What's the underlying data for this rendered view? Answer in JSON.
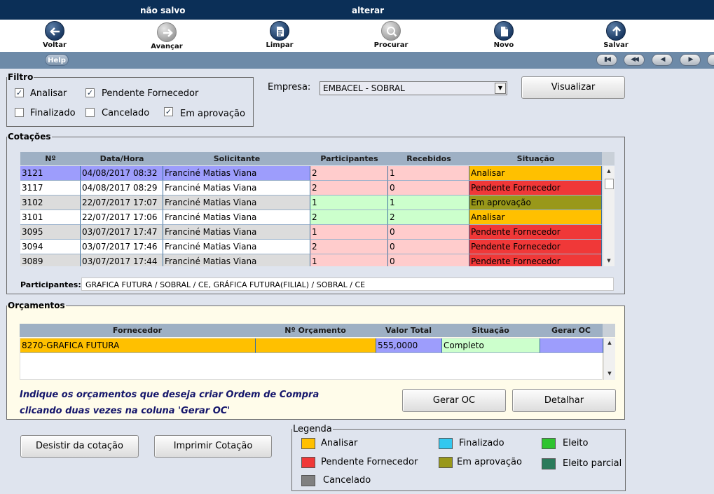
{
  "topbar": {
    "status": "não salvo",
    "mode": "alterar"
  },
  "toolbar": [
    {
      "label": "Voltar",
      "icon": "arrow-left-icon"
    },
    {
      "label": "Avançar",
      "icon": "arrow-right-icon"
    },
    {
      "label": "Limpar",
      "icon": "clear-document-icon"
    },
    {
      "label": "Procurar",
      "icon": "search-icon"
    },
    {
      "label": "Novo",
      "icon": "new-document-icon"
    },
    {
      "label": "Salvar",
      "icon": "save-up-arrow-icon"
    }
  ],
  "helpbar": {
    "help_label": "Help",
    "nav_icons": [
      "first-page-icon",
      "rewind-icon",
      "previous-icon",
      "next-icon",
      "last-icon"
    ]
  },
  "filtro": {
    "title": "Filtro",
    "options": [
      {
        "label": "Analisar",
        "checked": true
      },
      {
        "label": "Pendente Fornecedor",
        "checked": true
      },
      {
        "label": "Finalizado",
        "checked": false
      },
      {
        "label": "Cancelado",
        "checked": false
      },
      {
        "label": "Em aprovação",
        "checked": true
      }
    ]
  },
  "empresa": {
    "label": "Empresa:",
    "value": "EMBACEL - SOBRAL"
  },
  "buttons": {
    "visualizar": "Visualizar",
    "gerar_oc": "Gerar OC",
    "detalhar": "Detalhar",
    "desistir": "Desistir da cotação",
    "imprimir": "Imprimir Cotação"
  },
  "cotacoes": {
    "title": "Cotações",
    "columns": [
      "Nº",
      "Data/Hora",
      "Solicitante",
      "Participantes",
      "Recebidos",
      "Situação"
    ],
    "rows": [
      {
        "n": "3121",
        "data": "04/08/2017 08:32",
        "solicitante": "Franciné Matias Viana",
        "participantes": "2",
        "recebidos": "1",
        "situacao": "Analisar",
        "selected": true
      },
      {
        "n": "3117",
        "data": "04/08/2017 08:29",
        "solicitante": "Franciné Matias Viana",
        "participantes": "2",
        "recebidos": "0",
        "situacao": "Pendente Fornecedor"
      },
      {
        "n": "3102",
        "data": "22/07/2017 17:07",
        "solicitante": "Franciné Matias Viana",
        "participantes": "1",
        "recebidos": "1",
        "situacao": "Em aprovação"
      },
      {
        "n": "3101",
        "data": "22/07/2017 17:06",
        "solicitante": "Franciné Matias Viana",
        "participantes": "2",
        "recebidos": "2",
        "situacao": "Analisar"
      },
      {
        "n": "3095",
        "data": "03/07/2017 17:47",
        "solicitante": "Franciné Matias Viana",
        "participantes": "1",
        "recebidos": "0",
        "situacao": "Pendente Fornecedor"
      },
      {
        "n": "3094",
        "data": "03/07/2017 17:46",
        "solicitante": "Franciné Matias Viana",
        "participantes": "2",
        "recebidos": "0",
        "situacao": "Pendente Fornecedor"
      },
      {
        "n": "3089",
        "data": "03/07/2017 17:44",
        "solicitante": "Franciné Matias Viana",
        "participantes": "1",
        "recebidos": "0",
        "situacao": "Pendente Fornecedor"
      }
    ],
    "participantes_label": "Participantes:",
    "participantes_value": "GRAFICA FUTURA / SOBRAL / CE,   GRÁFICA FUTURA(FILIAL) / SOBRAL / CE"
  },
  "orcamentos": {
    "title": "Orçamentos",
    "columns": [
      "Fornecedor",
      "Nº Orçamento",
      "Valor Total",
      "Situação",
      "Gerar OC"
    ],
    "rows": [
      {
        "fornecedor": "8270-GRAFICA FUTURA",
        "numero": "",
        "valor": "555,0000",
        "situacao": "Completo",
        "gerar": ""
      }
    ],
    "hint_line1": "Indique os orçamentos que deseja criar Ordem de Compra",
    "hint_line2": "clicando duas vezes na coluna 'Gerar OC'"
  },
  "legenda": {
    "title": "Legenda",
    "items": [
      {
        "label": "Analisar",
        "color": "#ffc000"
      },
      {
        "label": "Finalizado",
        "color": "#33c8f0"
      },
      {
        "label": "Eleito",
        "color": "#2fc42f"
      },
      {
        "label": "Pendente Fornecedor",
        "color": "#f03838"
      },
      {
        "label": "Em aprovação",
        "color": "#99981a"
      },
      {
        "label": "Eleito parcial",
        "color": "#2a7a5a"
      },
      {
        "label": "Cancelado",
        "color": "#808080"
      }
    ]
  },
  "colors": {
    "analisar": "#ffc000",
    "pendente": "#f03838",
    "em_aprovacao": "#99981a",
    "selected_row": "#9d9dfc",
    "pink_cell": "#ffcccc",
    "green_cell": "#ccffcc"
  }
}
